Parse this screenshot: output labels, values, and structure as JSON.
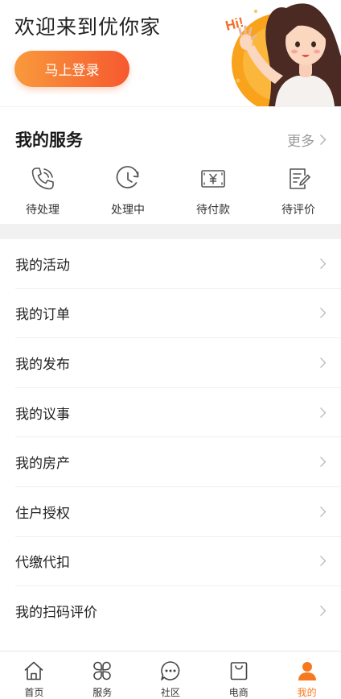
{
  "header": {
    "welcome": "欢迎来到优你家",
    "login_label": "马上登录",
    "hero_text": "Hi!"
  },
  "services": {
    "title": "我的服务",
    "more_label": "更多",
    "items": [
      {
        "label": "待处理",
        "icon": "phone-pending-icon"
      },
      {
        "label": "处理中",
        "icon": "clock-icon"
      },
      {
        "label": "待付款",
        "icon": "yuan-payment-icon"
      },
      {
        "label": "待评价",
        "icon": "edit-review-icon"
      }
    ]
  },
  "menu": {
    "items": [
      {
        "label": "我的活动"
      },
      {
        "label": "我的订单"
      },
      {
        "label": "我的发布"
      },
      {
        "label": "我的议事"
      },
      {
        "label": "我的房产"
      },
      {
        "label": "住户授权"
      },
      {
        "label": "代缴代扣"
      },
      {
        "label": "我的扫码评价"
      }
    ]
  },
  "tabbar": {
    "items": [
      {
        "label": "首页",
        "icon": "home-icon"
      },
      {
        "label": "服务",
        "icon": "clover-grid-icon"
      },
      {
        "label": "社区",
        "icon": "chat-bubble-icon"
      },
      {
        "label": "电商",
        "icon": "shopping-bag-icon"
      },
      {
        "label": "我的",
        "icon": "user-icon",
        "active": true
      }
    ]
  },
  "colors": {
    "accent": "#f7791f",
    "login_gradient_start": "#f89a3c",
    "login_gradient_end": "#f6592f"
  }
}
